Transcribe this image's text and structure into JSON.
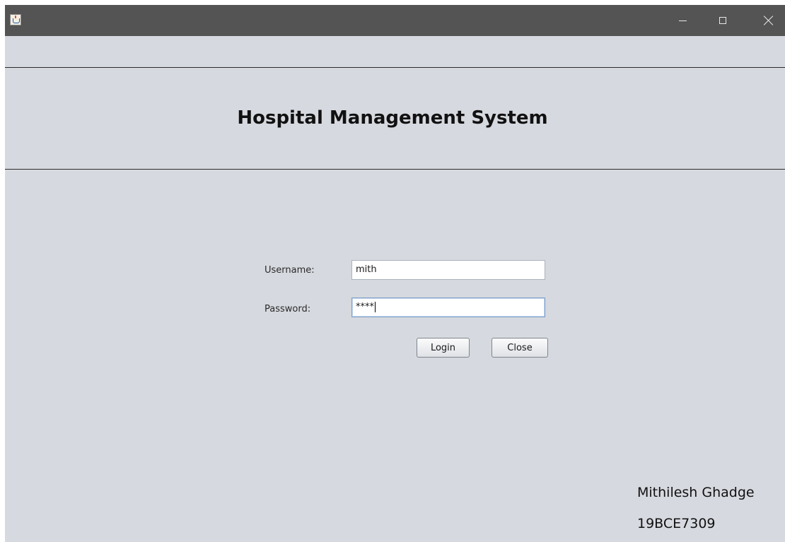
{
  "window": {
    "title": "",
    "app_icon": "java-cup-icon",
    "controls": {
      "minimize_icon": "minimize-icon",
      "maximize_icon": "maximize-icon",
      "close_icon": "close-icon"
    }
  },
  "header": {
    "title": "Hospital Management System"
  },
  "login_form": {
    "username_label": "Username:",
    "username_value": "mith",
    "password_label": "Password:",
    "password_value": "****",
    "login_label": "Login",
    "close_label": "Close"
  },
  "footer": {
    "author_name": "Mithilesh Ghadge",
    "author_id": "19BCE7309"
  },
  "colors": {
    "titlebar": "#545454",
    "window_background": "#d6d9df",
    "rule": "#2b2b2b",
    "focused_field_border": "#7a9ec9"
  }
}
